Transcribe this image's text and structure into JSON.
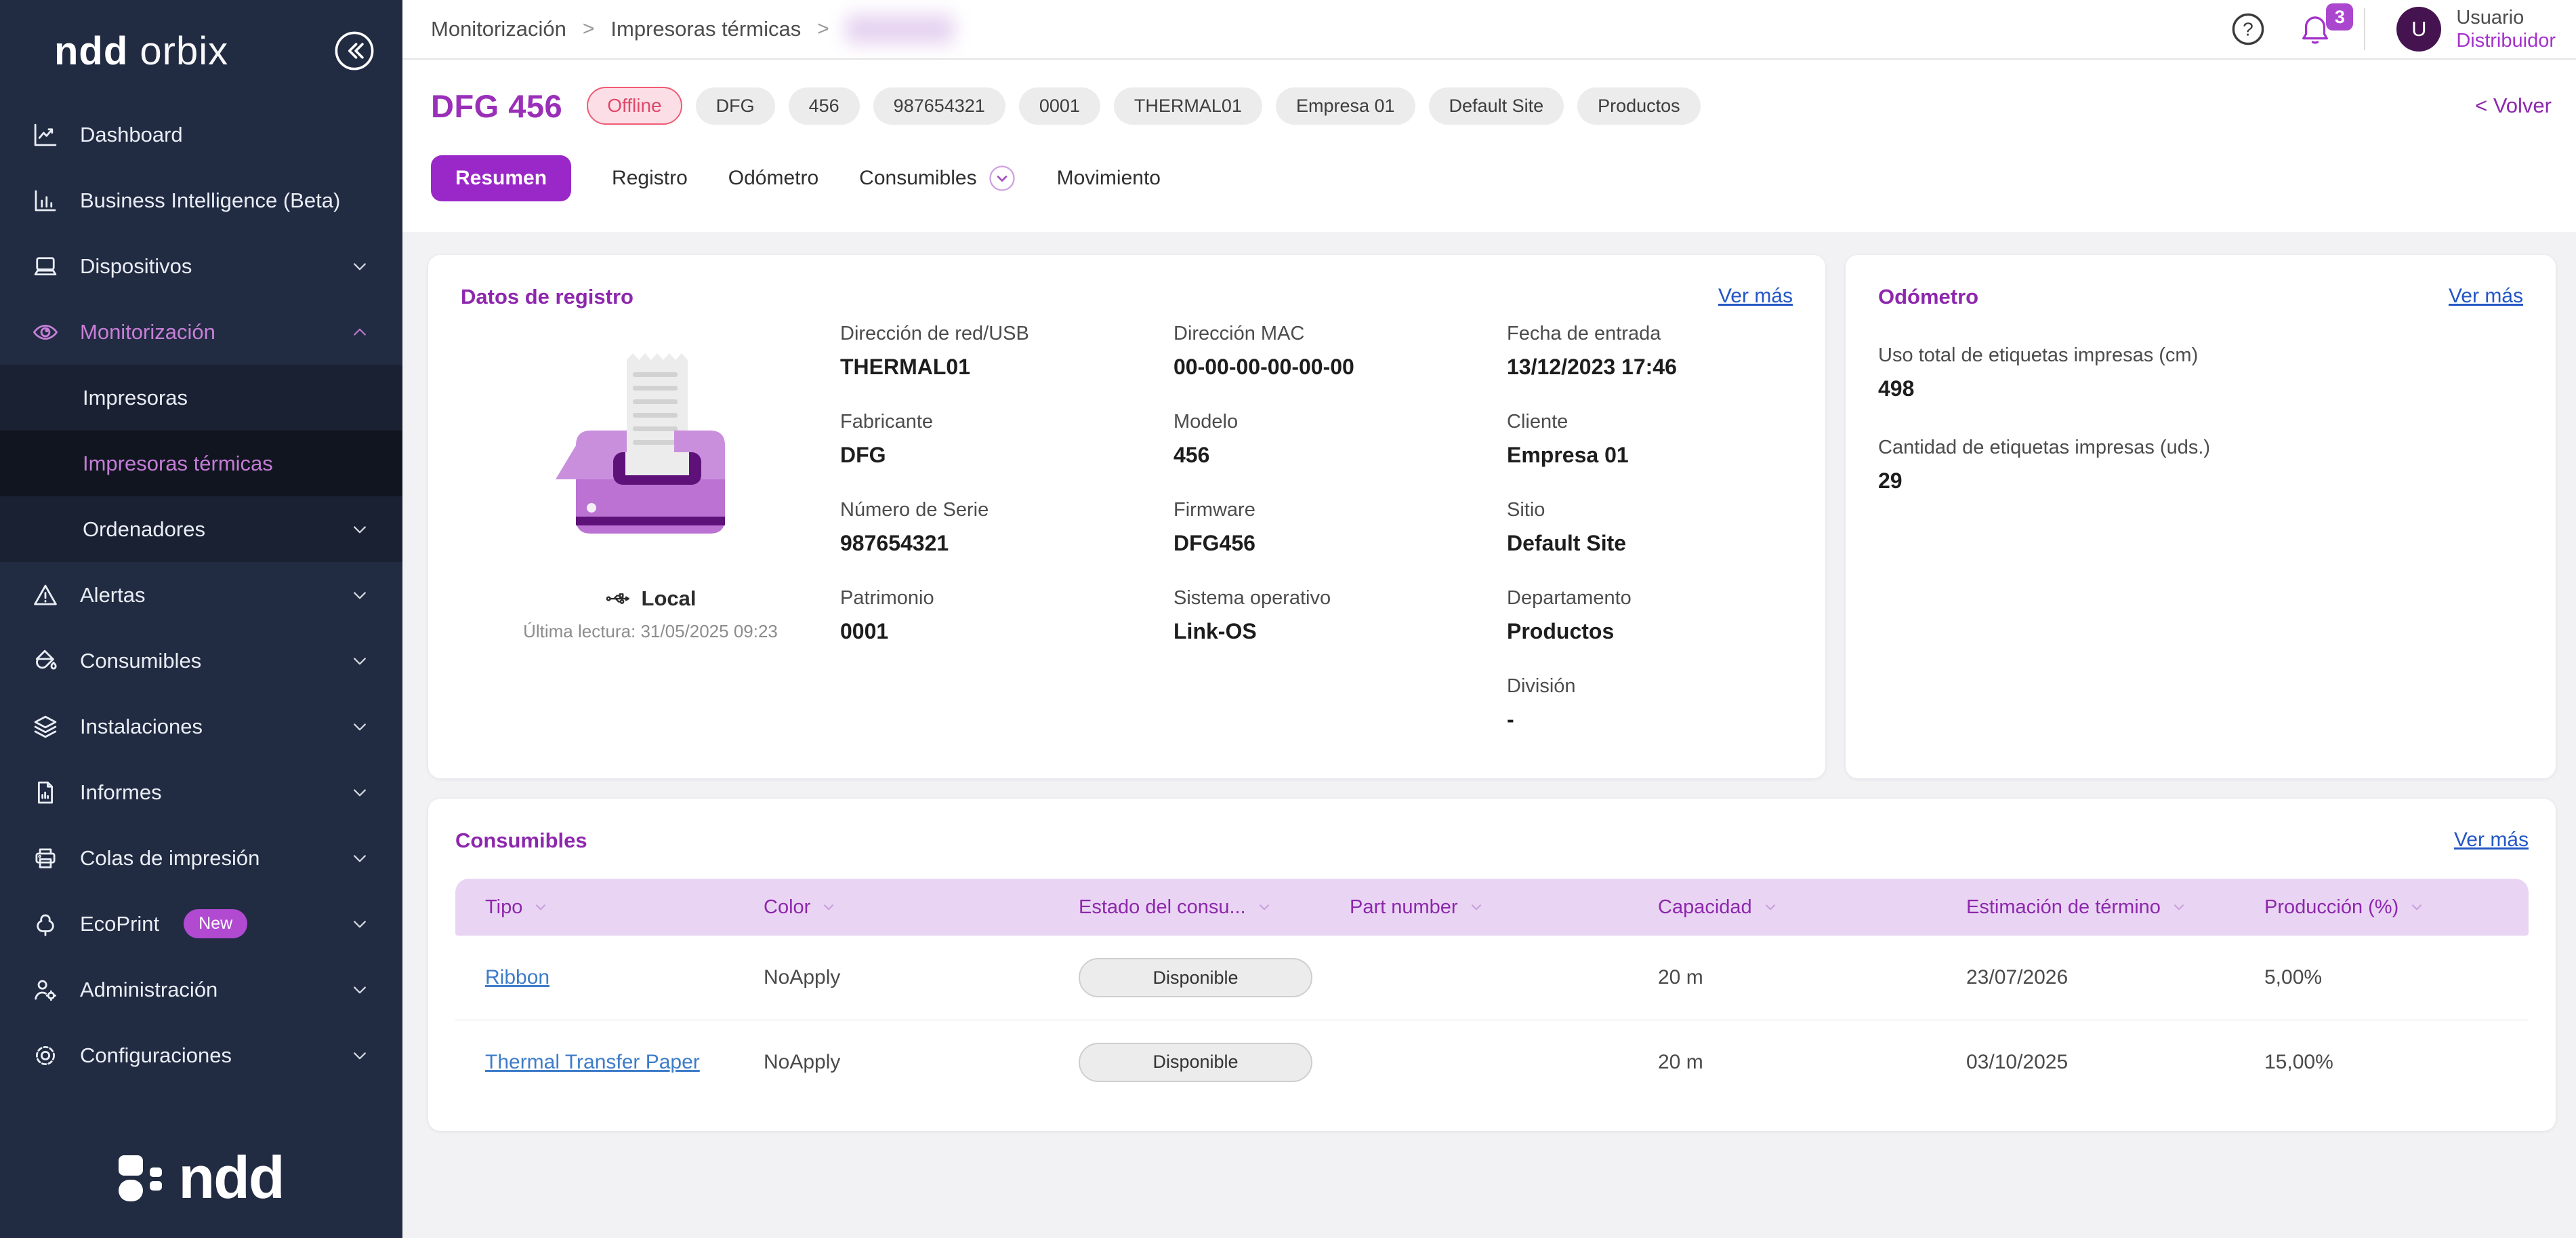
{
  "colors": {
    "sidebar_bg": "#212b42",
    "accent_purple": "#8d27ad",
    "tab_active_purple": "#9a27c7",
    "link_blue": "#2356c5",
    "offline_red": "#ef5b74",
    "table_header_bg": "#e9d5f3"
  },
  "sidebar": {
    "logo_bold": "ndd",
    "logo_light": "orbix",
    "items": [
      {
        "label": "Dashboard"
      },
      {
        "label": "Business Intelligence (Beta)"
      },
      {
        "label": "Dispositivos"
      },
      {
        "label": "Monitorización"
      },
      {
        "label": "Impresoras"
      },
      {
        "label": "Impresoras térmicas"
      },
      {
        "label": "Ordenadores"
      },
      {
        "label": "Alertas"
      },
      {
        "label": "Consumibles"
      },
      {
        "label": "Instalaciones"
      },
      {
        "label": "Informes"
      },
      {
        "label": "Colas de impresión"
      },
      {
        "label": "EcoPrint",
        "badge": "New"
      },
      {
        "label": "Administración"
      },
      {
        "label": "Configuraciones"
      }
    ],
    "footer_logo": "ndd"
  },
  "topbar": {
    "breadcrumb": [
      "Monitorización",
      "Impresoras térmicas"
    ],
    "notification_count": "3",
    "user_initial": "U",
    "user_name": "Usuario",
    "user_role": "Distribuidor"
  },
  "header": {
    "title": "DFG 456",
    "status": "Offline",
    "tags": [
      "DFG",
      "456",
      "987654321",
      "0001",
      "THERMAL01",
      "Empresa 01",
      "Default Site",
      "Productos"
    ],
    "back": "< Volver",
    "tabs": [
      "Resumen",
      "Registro",
      "Odómetro",
      "Consumibles",
      "Movimiento"
    ]
  },
  "registro": {
    "title": "Datos de registro",
    "more": "Ver más",
    "connection": "Local",
    "last_read": "Última lectura: 31/05/2025 09:23",
    "col1": [
      {
        "label": "Dirección de red/USB",
        "value": "THERMAL01"
      },
      {
        "label": "Fabricante",
        "value": "DFG"
      },
      {
        "label": "Número de Serie",
        "value": "987654321"
      },
      {
        "label": "Patrimonio",
        "value": "0001"
      }
    ],
    "col2": [
      {
        "label": "Dirección MAC",
        "value": "00-00-00-00-00-00"
      },
      {
        "label": "Modelo",
        "value": "456"
      },
      {
        "label": "Firmware",
        "value": "DFG456"
      },
      {
        "label": "Sistema operativo",
        "value": "Link-OS"
      }
    ],
    "col3": [
      {
        "label": "Fecha de entrada",
        "value": "13/12/2023 17:46"
      },
      {
        "label": "Cliente",
        "value": "Empresa 01"
      },
      {
        "label": "Sitio",
        "value": "Default Site"
      },
      {
        "label": "Departamento",
        "value": "Productos"
      },
      {
        "label": "División",
        "value": "-"
      }
    ]
  },
  "odometro": {
    "title": "Odómetro",
    "more": "Ver más",
    "fields": [
      {
        "label": "Uso total de etiquetas impresas (cm)",
        "value": "498"
      },
      {
        "label": "Cantidad de etiquetas impresas (uds.)",
        "value": "29"
      }
    ]
  },
  "consumibles": {
    "title": "Consumibles",
    "more": "Ver más",
    "columns": [
      "Tipo",
      "Color",
      "Estado del consu...",
      "Part number",
      "Capacidad",
      "Estimación de término",
      "Producción (%)"
    ],
    "rows": [
      {
        "tipo": "Ribbon",
        "color": "NoApply",
        "estado": "Disponible",
        "part": "",
        "capacidad": "20 m",
        "estimacion": "23/07/2026",
        "produccion": "5,00%"
      },
      {
        "tipo": "Thermal Transfer Paper",
        "color": "NoApply",
        "estado": "Disponible",
        "part": "",
        "capacidad": "20 m",
        "estimacion": "03/10/2025",
        "produccion": "15,00%"
      }
    ]
  }
}
